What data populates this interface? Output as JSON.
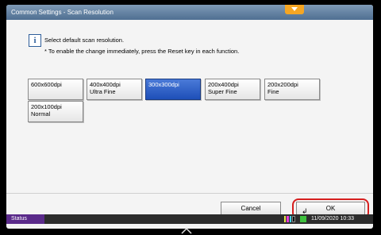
{
  "title": "Common Settings - Scan Resolution",
  "message": {
    "line1": "Select default scan resolution.",
    "line2": "* To enable the change immediately, press the Reset key in each function."
  },
  "options": [
    {
      "line1": "600x600dpi",
      "line2": "",
      "selected": false
    },
    {
      "line1": "400x400dpi",
      "line2": "Ultra Fine",
      "selected": false
    },
    {
      "line1": "300x300dpi",
      "line2": "",
      "selected": true
    },
    {
      "line1": "200x400dpi",
      "line2": "Super Fine",
      "selected": false
    },
    {
      "line1": "200x200dpi",
      "line2": "Fine",
      "selected": false
    },
    {
      "line1": "200x100dpi",
      "line2": "Normal",
      "selected": false
    }
  ],
  "buttons": {
    "cancel": "Cancel",
    "ok": "OK"
  },
  "status": {
    "label": "Status",
    "datetime": "11/09/2020  10:33"
  },
  "colors": {
    "title_bar": "#5e7fa3",
    "selected": "#2b5fc8",
    "status_label": "#5a2a8a",
    "ok_highlight": "#d61f1f"
  }
}
